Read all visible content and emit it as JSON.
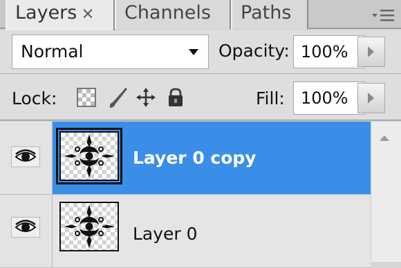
{
  "tabs": [
    {
      "label": "Layers",
      "close": "×",
      "active": true
    },
    {
      "label": "Channels",
      "active": false
    },
    {
      "label": "Paths",
      "active": false
    }
  ],
  "panel_menu_icon": "panel-menu-icon",
  "blend": {
    "value": "Normal"
  },
  "opacity": {
    "label": "Opacity:",
    "value": "100%"
  },
  "lock": {
    "label": "Lock:",
    "icons": [
      "lock-transparent-pixels-icon",
      "lock-image-pixels-icon",
      "lock-position-icon",
      "lock-all-icon"
    ]
  },
  "fill": {
    "label": "Fill:",
    "value": "100%"
  },
  "layers": [
    {
      "name": "Layer 0 copy",
      "visible": true,
      "selected": true
    },
    {
      "name": "Layer 0",
      "visible": true,
      "selected": false
    }
  ],
  "colors": {
    "selection": "#3a8ee8",
    "panel": "#dedede"
  }
}
